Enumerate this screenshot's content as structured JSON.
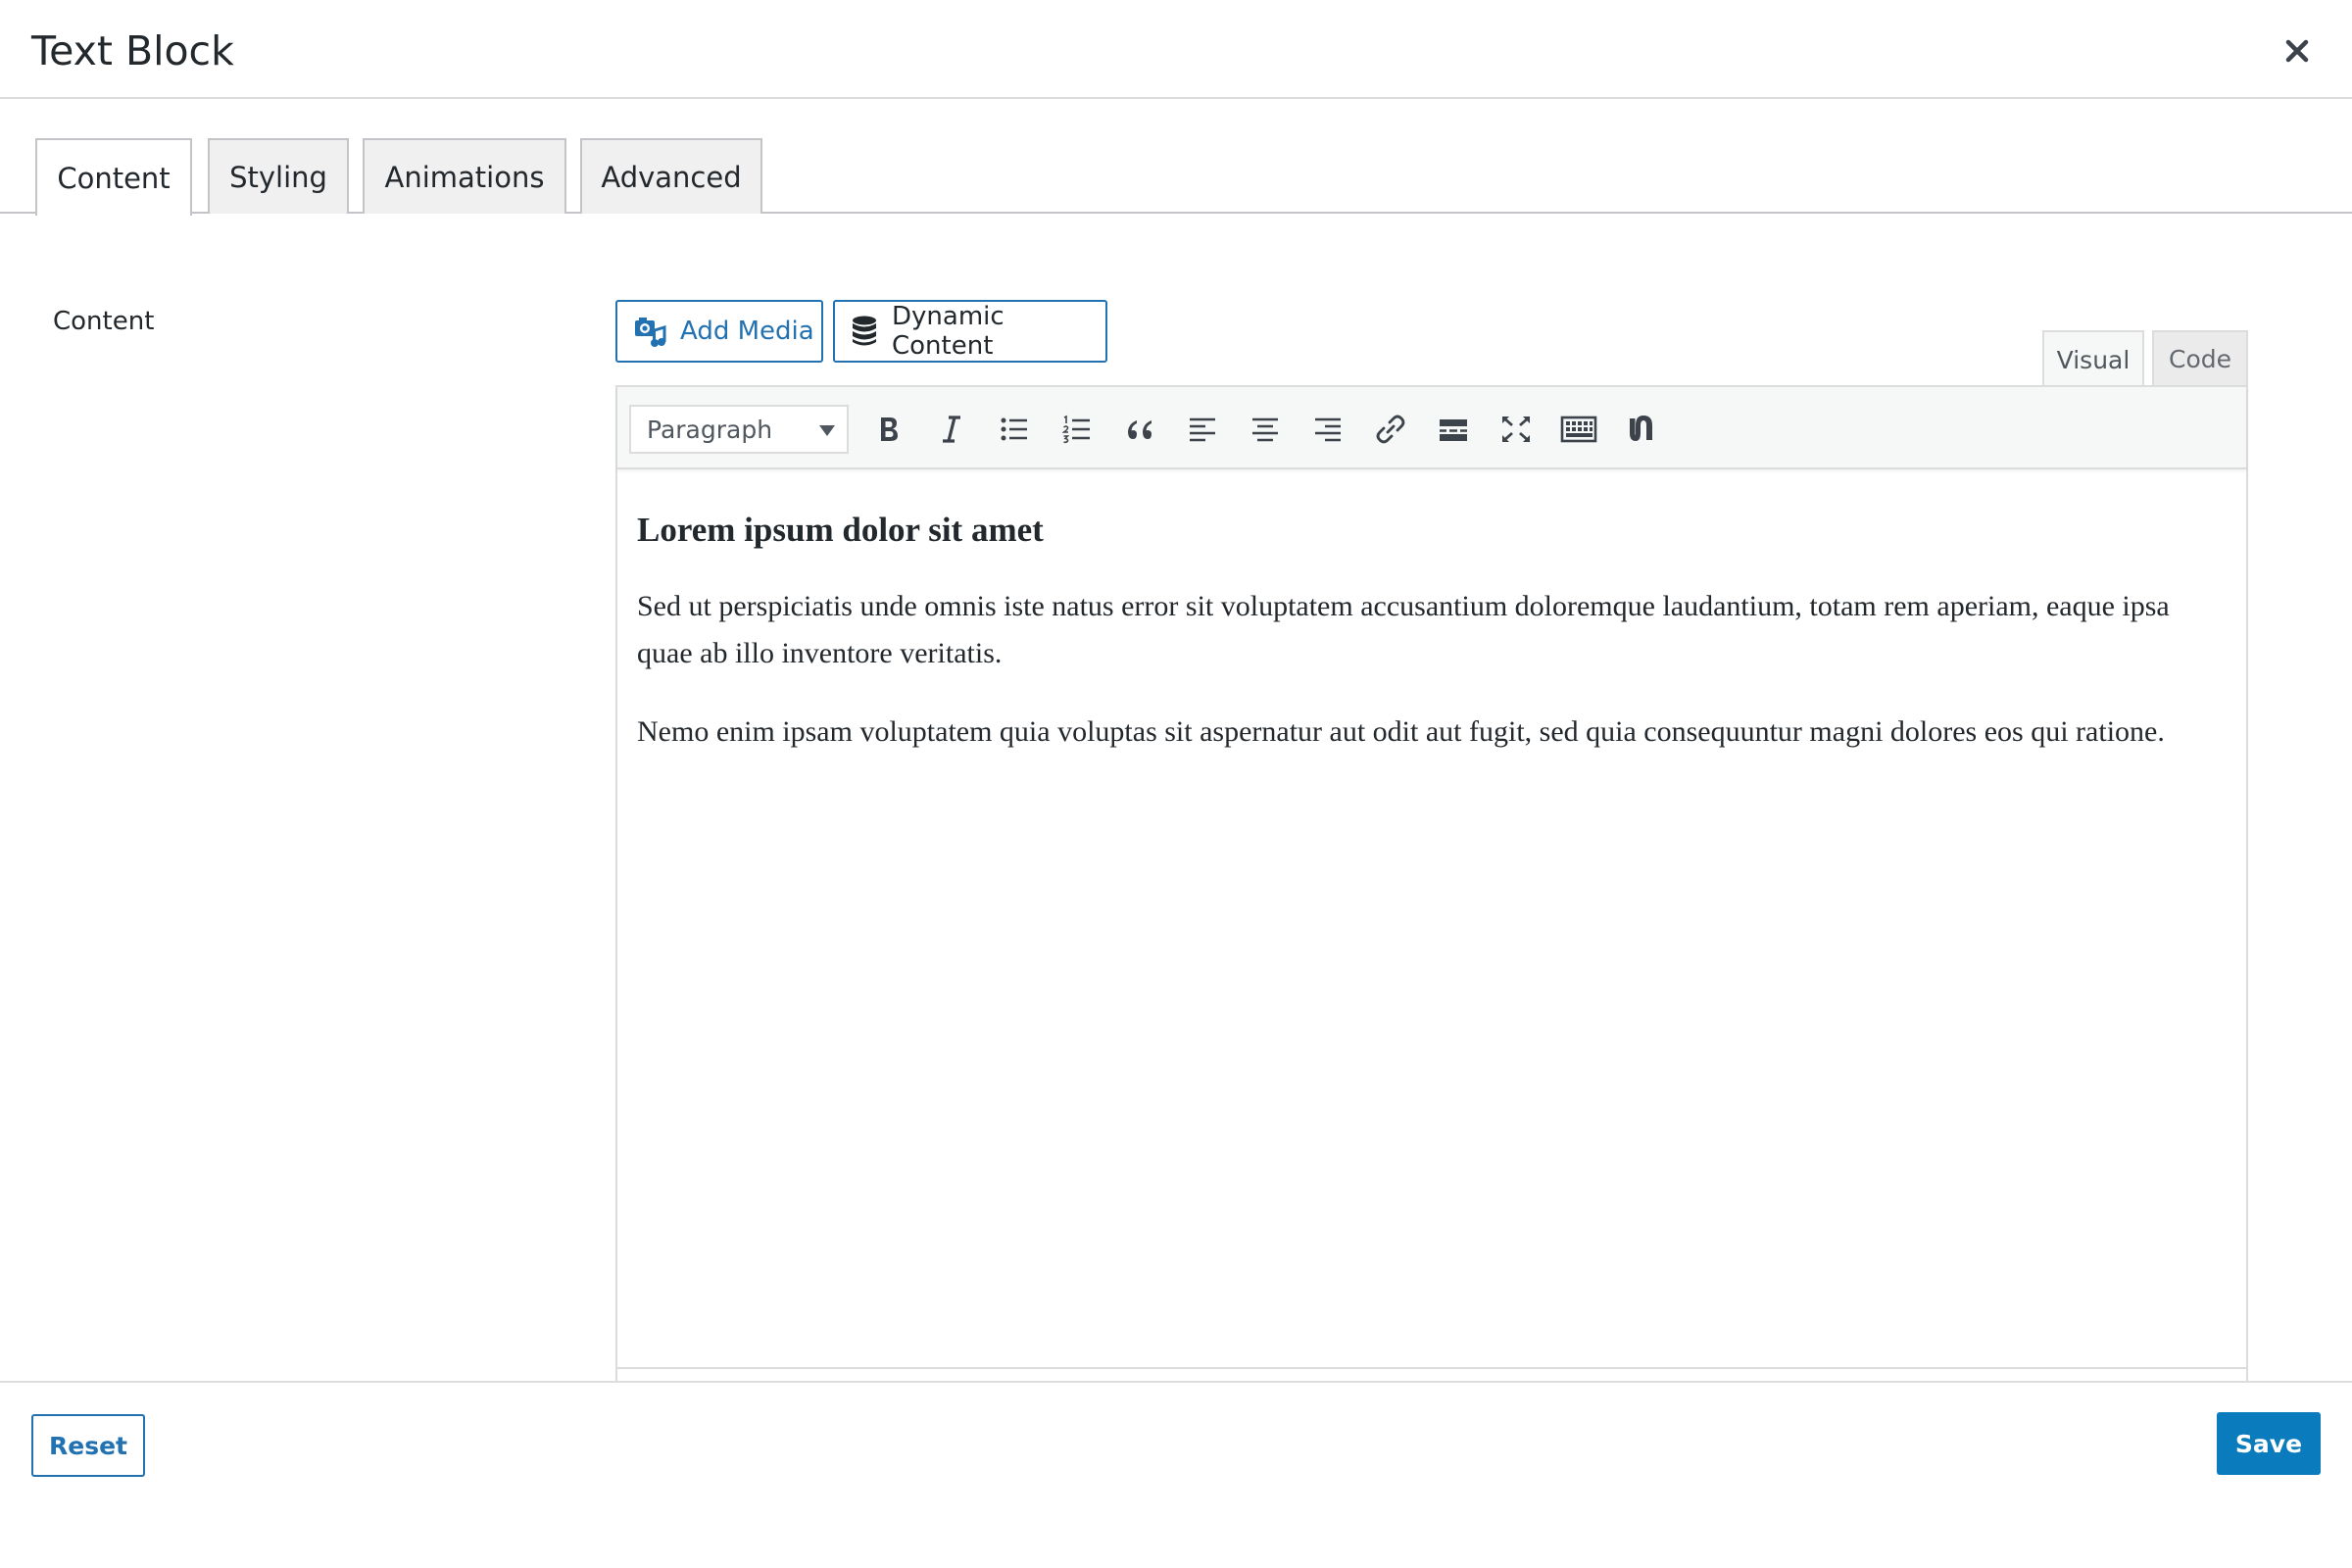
{
  "modal": {
    "title": "Text Block",
    "close_icon": "close-icon"
  },
  "tabs": [
    {
      "label": "Content",
      "active": true
    },
    {
      "label": "Styling",
      "active": false
    },
    {
      "label": "Animations",
      "active": false
    },
    {
      "label": "Advanced",
      "active": false
    }
  ],
  "field": {
    "label": "Content"
  },
  "media_buttons": {
    "add_media": "Add Media",
    "dynamic_content": "Dynamic Content"
  },
  "editor_modes": {
    "visual": "Visual",
    "code": "Code",
    "active": "visual"
  },
  "toolbar": {
    "format_selected": "Paragraph",
    "buttons": [
      "bold-icon",
      "italic-icon",
      "bulleted-list-icon",
      "numbered-list-icon",
      "blockquote-icon",
      "align-left-icon",
      "align-center-icon",
      "align-right-icon",
      "link-icon",
      "read-more-icon",
      "fullscreen-icon",
      "toolbar-toggle-icon",
      "shortcode-icon"
    ]
  },
  "content": {
    "heading": "Lorem ipsum dolor sit amet",
    "paragraphs": [
      "Sed ut perspiciatis unde omnis iste natus error sit voluptatem accusantium doloremque laudantium, totam rem aperiam, eaque ipsa quae ab illo inventore veritatis.",
      "Nemo enim ipsam voluptatem quia voluptas sit aspernatur aut odit aut fugit, sed quia consequuntur magni dolores eos qui ratione."
    ]
  },
  "footer": {
    "reset_label": "Reset",
    "save_label": "Save"
  },
  "colors": {
    "accent": "#2271b1",
    "save_bg": "#0a7bbd",
    "text": "#23282d",
    "border": "#dcdcde"
  }
}
